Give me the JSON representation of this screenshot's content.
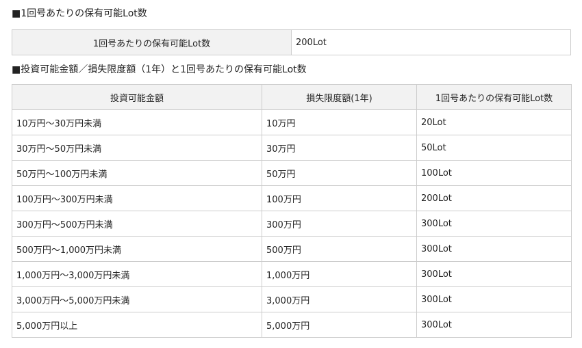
{
  "section1": {
    "heading": "■1回号あたりの保有可能Lot数",
    "label": "1回号あたりの保有可能Lot数",
    "value": "200Lot"
  },
  "section2": {
    "heading": "■投資可能金額／損失限度額（1年）と1回号あたりの保有可能Lot数",
    "headers": [
      "投資可能金額",
      "損失限度額(1年)",
      "1回号あたりの保有可能Lot数"
    ],
    "rows": [
      [
        "10万円～30万円未満",
        "10万円",
        "20Lot"
      ],
      [
        "30万円～50万円未満",
        "30万円",
        "50Lot"
      ],
      [
        "50万円～100万円未満",
        "50万円",
        "100Lot"
      ],
      [
        "100万円～300万円未満",
        "100万円",
        "200Lot"
      ],
      [
        "300万円～500万円未満",
        "300万円",
        "300Lot"
      ],
      [
        "500万円～1,000万円未満",
        "500万円",
        "300Lot"
      ],
      [
        "1,000万円～3,000万円未満",
        "1,000万円",
        "300Lot"
      ],
      [
        "3,000万円～5,000万円未満",
        "3,000万円",
        "300Lot"
      ],
      [
        "5,000万円以上",
        "5,000万円",
        "300Lot"
      ]
    ]
  }
}
